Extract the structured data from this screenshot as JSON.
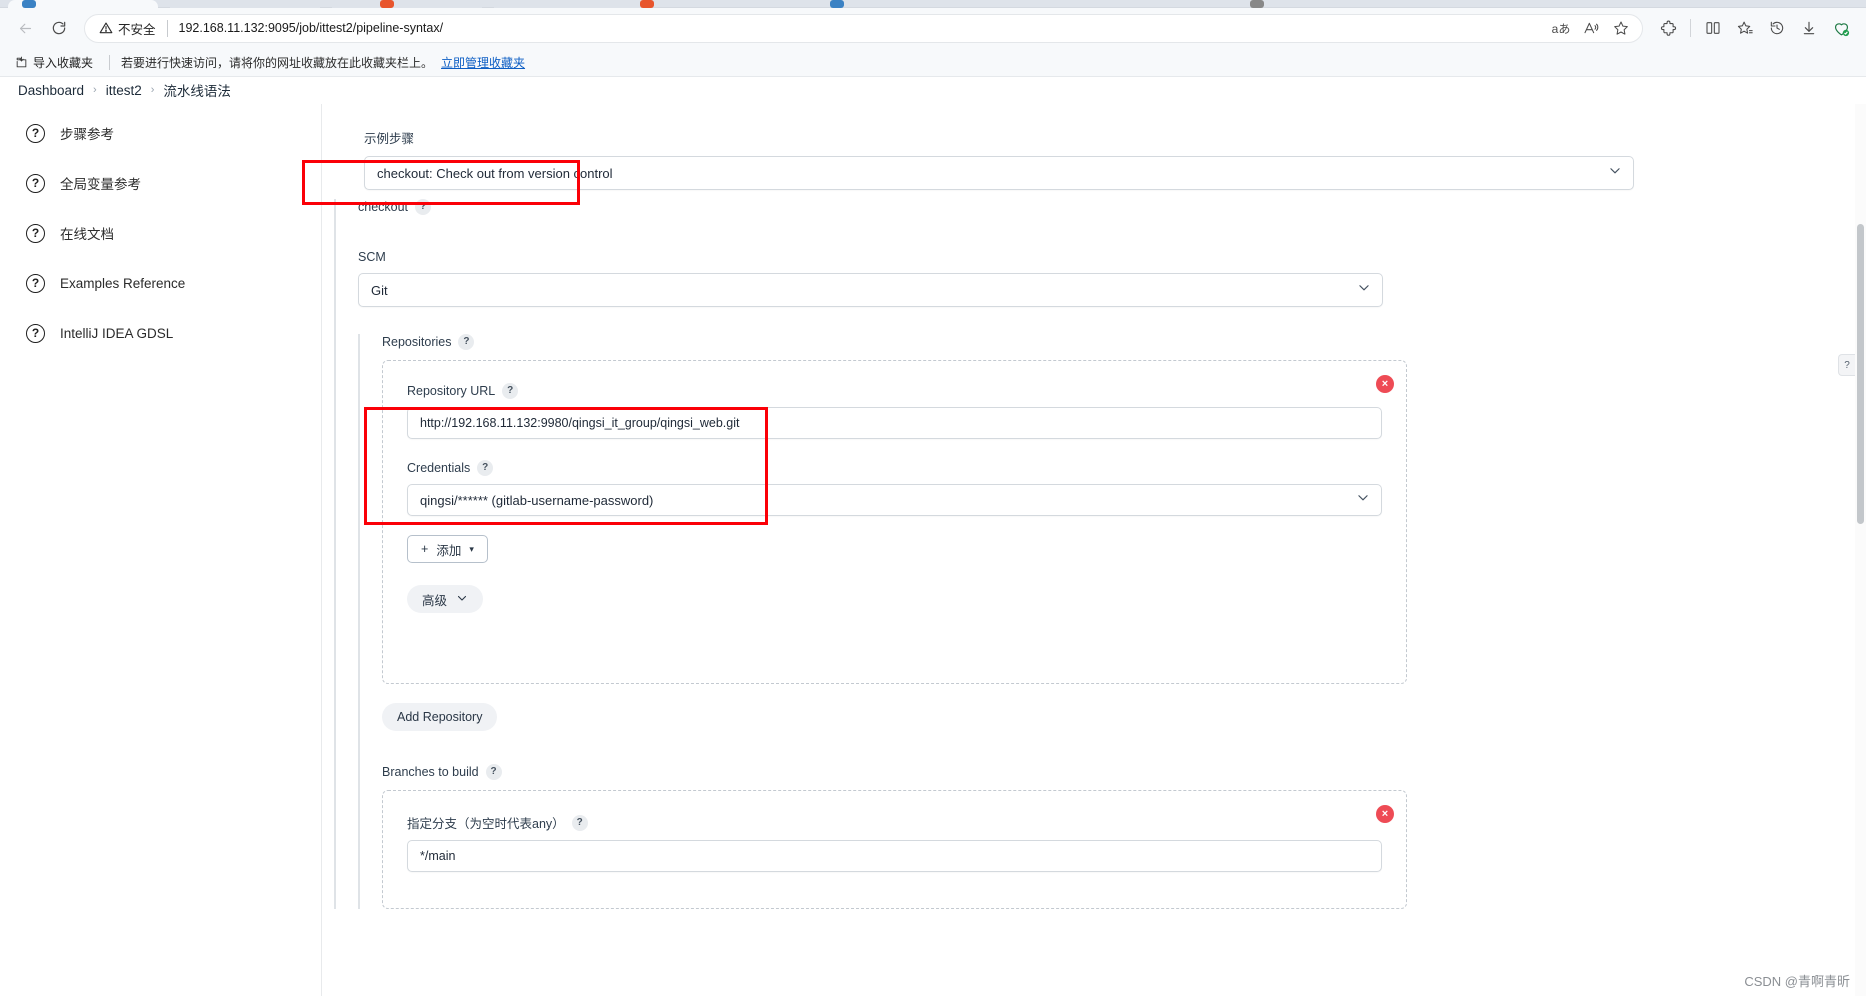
{
  "browser": {
    "nav": {
      "back_icon": "arrow-left-icon",
      "refresh_icon": "refresh-icon"
    },
    "security_label": "不安全",
    "security_icon": "warning-triangle-icon",
    "url": "192.168.11.132:9095/job/ittest2/pipeline-syntax/",
    "omnibox_icons": [
      "translate-icon",
      "read-aloud-icon",
      "favorite-star-icon"
    ],
    "toolbar_icons": [
      "extensions-icon",
      "split-screen-icon",
      "favorites-icon",
      "history-icon",
      "downloads-icon",
      "browser-essentials-icon"
    ],
    "favorites": {
      "import_label": "导入收藏夹",
      "import_icon": "import-favorites-icon",
      "note": "若要进行快速访问，请将你的网址收藏放在此收藏夹栏上。",
      "manage_link": "立即管理收藏夹"
    }
  },
  "breadcrumb": {
    "items": [
      "Dashboard",
      "ittest2",
      "流水线语法"
    ],
    "separator": "›"
  },
  "sidebar": {
    "items": [
      {
        "icon": "help-circle-icon",
        "label": "步骤参考"
      },
      {
        "icon": "help-circle-icon",
        "label": "全局变量参考"
      },
      {
        "icon": "help-circle-icon",
        "label": "在线文档"
      },
      {
        "icon": "help-circle-icon",
        "label": "Examples Reference"
      },
      {
        "icon": "help-circle-icon",
        "label": "IntelliJ IDEA GDSL"
      }
    ]
  },
  "main": {
    "sample_step": {
      "label": "示例步骤",
      "value": "checkout: Check out from version control",
      "chevron_icon": "chevron-down-icon"
    },
    "step_title": {
      "label": "checkout",
      "help_icon": "?"
    },
    "scm": {
      "label": "SCM",
      "value": "Git",
      "chevron_icon": "chevron-down-icon"
    },
    "repositories": {
      "label": "Repositories",
      "help_icon": "?",
      "delete_icon": "×",
      "repository_url": {
        "label": "Repository URL",
        "help_icon": "?",
        "value": "http://192.168.11.132:9980/qingsi_it_group/qingsi_web.git"
      },
      "credentials": {
        "label": "Credentials",
        "help_icon": "?",
        "value": "qingsi/****** (gitlab-username-password)",
        "chevron_icon": "chevron-down-icon"
      },
      "add_button": {
        "label": "添加",
        "plus_icon": "+",
        "caret_icon": "▾"
      },
      "advanced_button": {
        "label": "高级",
        "chevron_icon": "⌄"
      }
    },
    "add_repository_button": "Add Repository",
    "branches": {
      "label": "Branches to build",
      "help_icon": "?",
      "delete_icon": "×",
      "branch_spec": {
        "label": "指定分支（为空时代表any）",
        "help_icon": "?",
        "value": "*/main"
      }
    },
    "side_help_tab": "?"
  },
  "watermark": "CSDN @青啊青昕",
  "colors": {
    "annotation_red": "#fb0007",
    "delete_red": "#ee4b55",
    "link_blue": "#0d5ec4"
  }
}
